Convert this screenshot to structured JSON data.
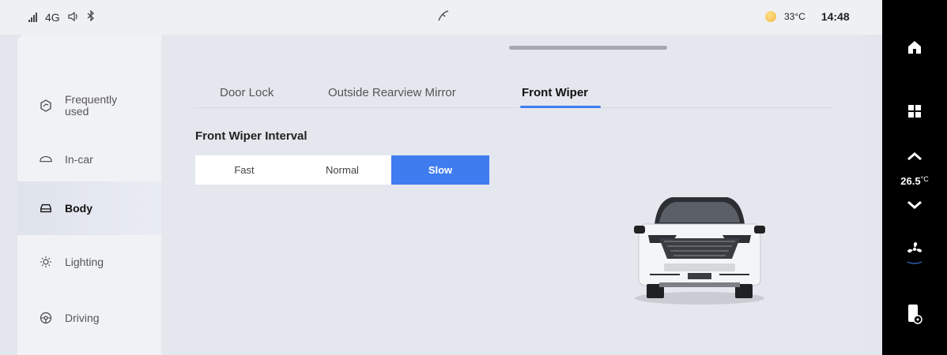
{
  "status_bar": {
    "network": "4G",
    "temperature": "33°C",
    "time": "14:48"
  },
  "sidebar": {
    "items": [
      {
        "label": "Frequently used",
        "icon": "cube-icon",
        "active": false
      },
      {
        "label": "In-car",
        "icon": "car-outline-icon",
        "active": false
      },
      {
        "label": "Body",
        "icon": "car-body-icon",
        "active": true
      },
      {
        "label": "Lighting",
        "icon": "sun-light-icon",
        "active": false
      },
      {
        "label": "Driving",
        "icon": "steering-wheel-icon",
        "active": false
      }
    ]
  },
  "tabs": [
    {
      "label": "Door Lock",
      "active": false
    },
    {
      "label": "Outside Rearview Mirror",
      "active": false
    },
    {
      "label": "Front Wiper",
      "active": true
    }
  ],
  "wiper": {
    "title": "Front Wiper Interval",
    "options": [
      "Fast",
      "Normal",
      "Slow"
    ],
    "selected": "Slow"
  },
  "dock": {
    "climate_temp": "26.5",
    "climate_unit": "°C"
  },
  "colors": {
    "accent": "#3f7cf0",
    "background": "#e4e7ed",
    "dock": "#000000"
  }
}
